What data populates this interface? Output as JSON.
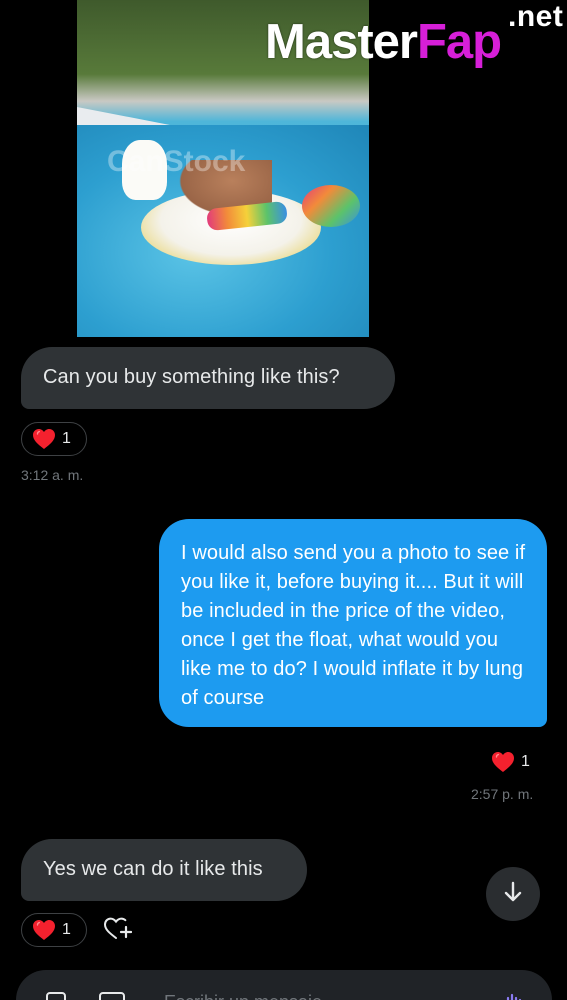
{
  "site_logo": {
    "main_text": "Master",
    "accent_text": "Fap",
    "suffix": ".net"
  },
  "photo": {
    "watermark": "CanStock"
  },
  "messages": [
    {
      "direction": "incoming",
      "text": "Can you buy something like this?",
      "reaction_count": "1",
      "timestamp": "3:12 a. m."
    },
    {
      "direction": "outgoing",
      "text": "I would also send you a photo to see if you like it, before buying it.... But it will be included in the price of the video, once I get the float, what would you like me to do? I would inflate it by lung of course",
      "reaction_count": "1",
      "timestamp": "2:57 p. m."
    },
    {
      "direction": "incoming",
      "text": "Yes we can do it like this",
      "reaction_count": "1"
    }
  ],
  "composer": {
    "placeholder": "Escribir un mensaje"
  },
  "colors": {
    "incoming_bubble": "#2f3336",
    "outgoing_bubble": "#1d9bf0",
    "heart": "#f4212e",
    "logo_accent": "#d61fd8"
  },
  "icons": {
    "reaction": "heart-icon",
    "add_reaction": "add-reaction-icon",
    "scroll": "arrow-down-icon",
    "gif": "gif-icon",
    "media": "media-icon",
    "voice": "voice-icon"
  }
}
